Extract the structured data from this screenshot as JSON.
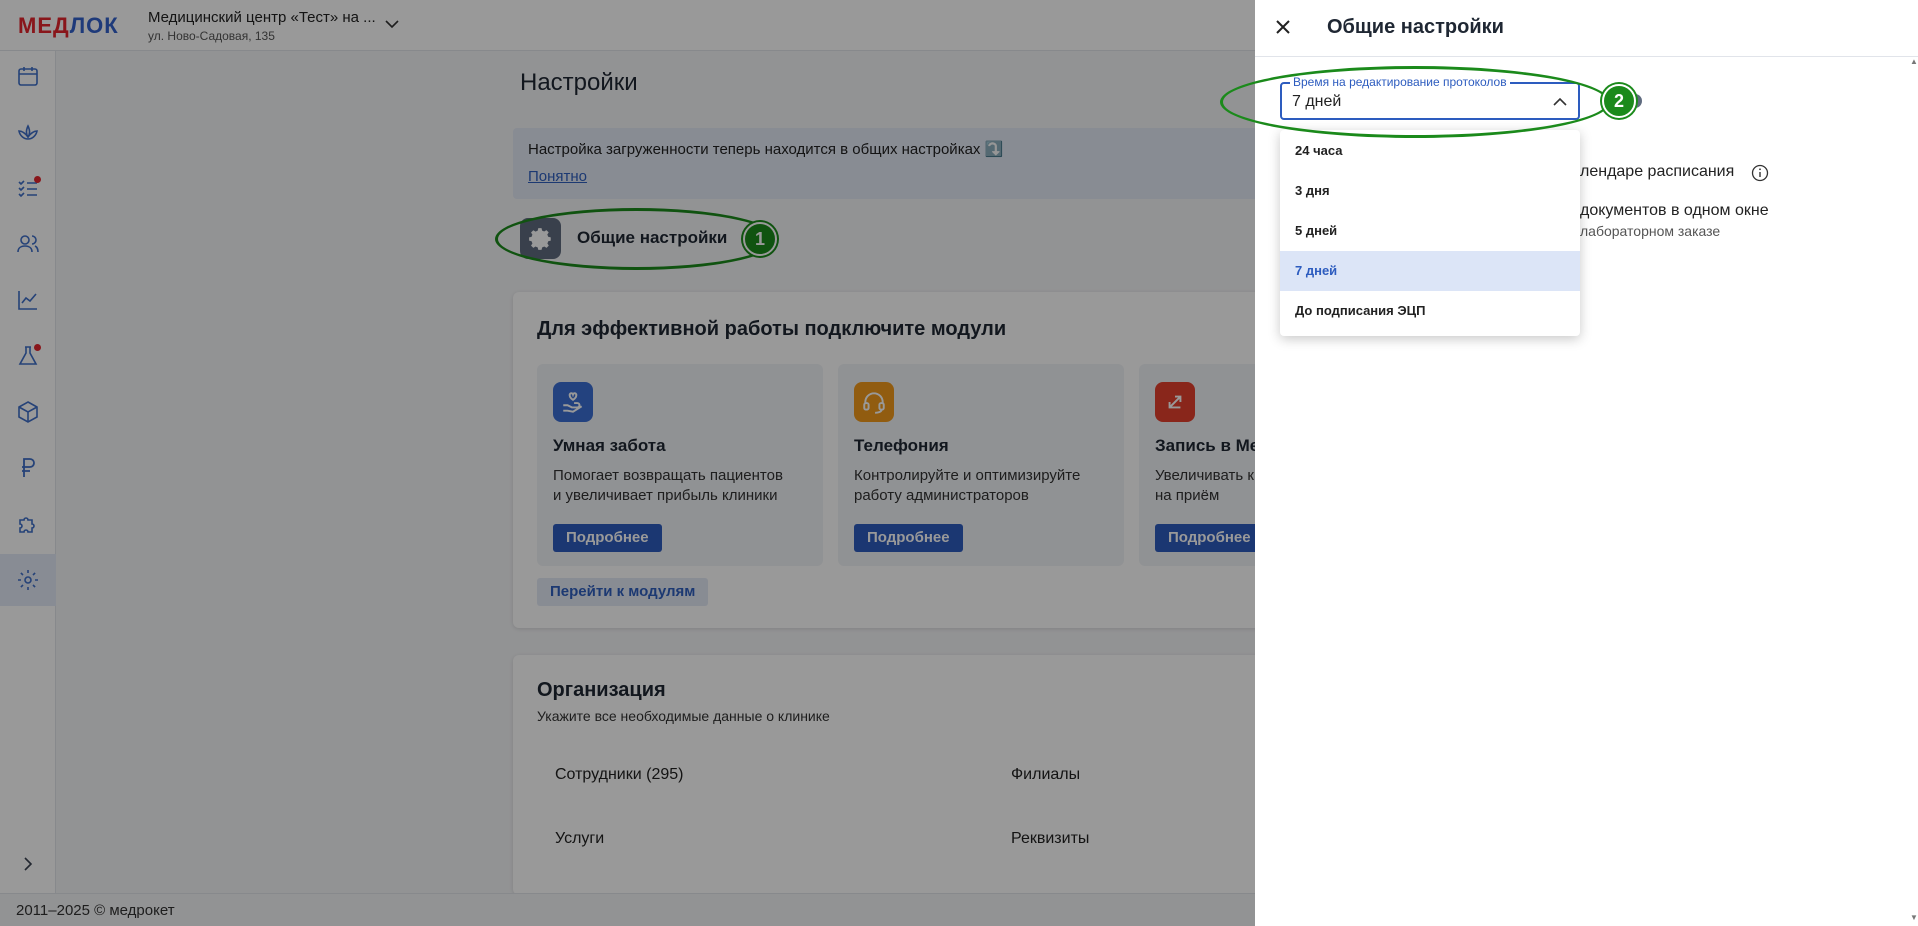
{
  "topbar": {
    "logo_part1": "МЕД",
    "logo_part2": "ЛОК",
    "clinic_name": "Медицинский центр «Тест» на ...",
    "clinic_address": "ул. Ново-Садовая, 135"
  },
  "sidebar": {
    "items": [
      {
        "icon": "calendar-icon"
      },
      {
        "icon": "lotus-icon"
      },
      {
        "icon": "tasks-icon",
        "badge": true
      },
      {
        "icon": "users-icon"
      },
      {
        "icon": "analytics-icon"
      },
      {
        "icon": "lab-flask-icon",
        "badge": true
      },
      {
        "icon": "box-icon"
      },
      {
        "icon": "ruble-icon"
      },
      {
        "icon": "puzzle-icon"
      },
      {
        "icon": "gear-icon",
        "active": true
      }
    ]
  },
  "footer": {
    "copyright": "2011–2025 © медрокет"
  },
  "page": {
    "title": "Настройки",
    "notice_text": "Настройка загруженности теперь находится в общих настройках ⤵️",
    "notice_link": "Понятно",
    "general_settings_label": "Общие настройки"
  },
  "modules": {
    "title": "Для эффективной работы подключите модули",
    "items": [
      {
        "name": "Умная забота",
        "desc_line1": "Помогает возвращать пациентов",
        "desc_line2": "и увеличивает прибыль клиники",
        "button": "Подробнее",
        "color": "#3b6fd4"
      },
      {
        "name": "Телефония",
        "desc_line1": "Контролируйте и оптимизируйте",
        "desc_line2": "работу администраторов",
        "button": "Подробнее",
        "color": "#f29a1b"
      },
      {
        "name": "Запись в Мед",
        "desc_line1": "Увеличивать к",
        "desc_line2": "на приём",
        "button": "Подробнее",
        "color": "#e5402d"
      }
    ],
    "go_to_modules": "Перейти к модулям"
  },
  "organization": {
    "title": "Организация",
    "subtitle": "Укажите все необходимые данные о клинике",
    "items": [
      "Сотрудники (295)",
      "Филиалы",
      "Услуги",
      "Реквизиты"
    ]
  },
  "drawer": {
    "title": "Общие настройки",
    "setting_calendar": "лендаре расписания",
    "setting_documents": "документов в одном окне",
    "setting_documents_sub": "лабораторном заказе",
    "select": {
      "label": "Время на редактирование протоколов",
      "value": "7 дней",
      "options": [
        "24 часа",
        "3 дня",
        "5 дней",
        "7 дней",
        "До подписания ЭЦП"
      ],
      "selected_index": 3
    }
  },
  "markers": [
    "1",
    "2"
  ],
  "colors": {
    "accent": "#2d5cbf",
    "marker": "#1b8a1b",
    "badge_red": "#e5262d"
  }
}
